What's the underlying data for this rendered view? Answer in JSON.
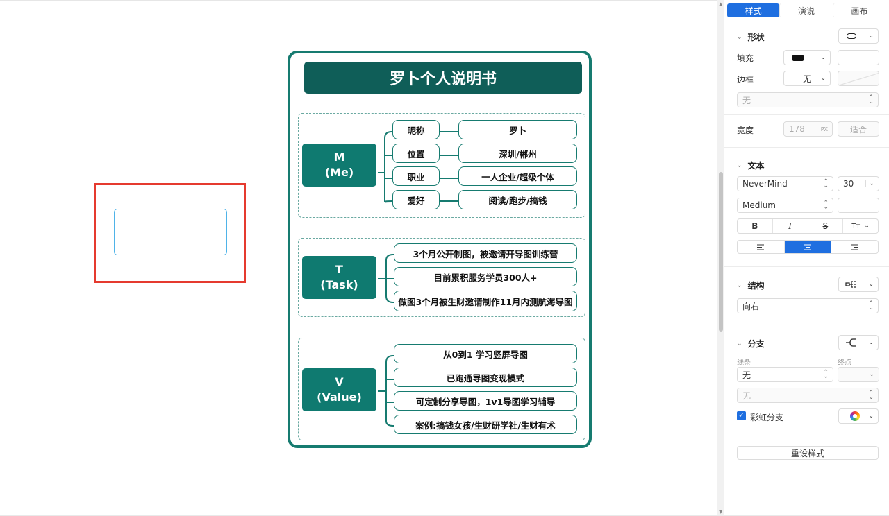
{
  "mindmap": {
    "title": "罗卜个人说明书",
    "sections": [
      {
        "root": [
          "M",
          "(Me)"
        ],
        "rows": [
          {
            "label": "昵称",
            "value": "罗卜"
          },
          {
            "label": "位置",
            "value": "深圳/郴州"
          },
          {
            "label": "职业",
            "value": "一人企业/超级个体"
          },
          {
            "label": "爱好",
            "value": "阅读/跑步/搞钱"
          }
        ]
      },
      {
        "root": [
          "T",
          "(Task)"
        ],
        "items": [
          "3个月公开制图，被邀请开导图训练营",
          "目前累积服务学员300人+",
          "做图3个月被生财邀请制作11月内测航海导图"
        ]
      },
      {
        "root": [
          "V",
          "(Value)"
        ],
        "items": [
          "从0到1 学习竖屏导图",
          "已跑通导图变现模式",
          "可定制分享导图，1v1导图学习辅导",
          "案例:搞钱女孩/生财研学社/生财有术"
        ]
      }
    ]
  },
  "panel": {
    "tabs": [
      "样式",
      "演说",
      "画布"
    ],
    "active_tab": "样式",
    "shape": {
      "heading": "形状",
      "fill_label": "填充",
      "border_label": "边框",
      "border_value": "无",
      "style_value": "无",
      "width_label": "宽度",
      "width_value": "178",
      "width_unit": "PX",
      "fit_label": "适合"
    },
    "text": {
      "heading": "文本",
      "font": "NeverMind",
      "size": "30",
      "weight": "Medium",
      "format_buttons": [
        "B",
        "I",
        "S",
        "Tт"
      ]
    },
    "structure": {
      "heading": "结构",
      "direction": "向右"
    },
    "branch": {
      "heading": "分支",
      "line_label": "线条",
      "end_label": "终点",
      "line_value": "无",
      "end_value": "—",
      "extra_value": "无",
      "rainbow_label": "彩虹分支",
      "rainbow_checked": true
    },
    "reset_label": "重设样式"
  },
  "colors": {
    "accent": "#1f6fe0",
    "card_border": "#167b70",
    "title_bg": "#0f5e58",
    "root_bg": "#0f7a70",
    "selection_red": "#e53a2f",
    "selection_blue": "#4fb3e8"
  }
}
